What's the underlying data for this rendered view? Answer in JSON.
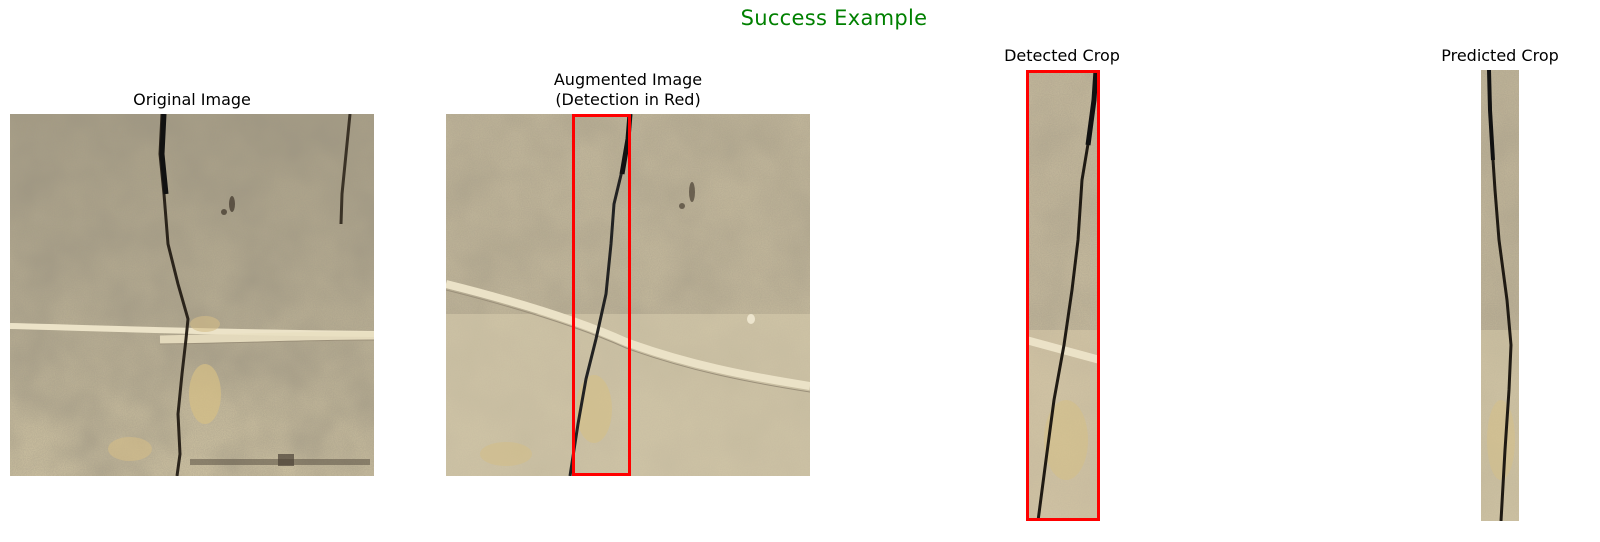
{
  "figure": {
    "title": "Success Example",
    "title_color": "#008000",
    "box_color": "#ff0000"
  },
  "panels": [
    {
      "title": "Original Image"
    },
    {
      "title": "Augmented Image\n(Detection in Red)"
    },
    {
      "title": "Detected Crop"
    },
    {
      "title": "Predicted Crop"
    }
  ]
}
